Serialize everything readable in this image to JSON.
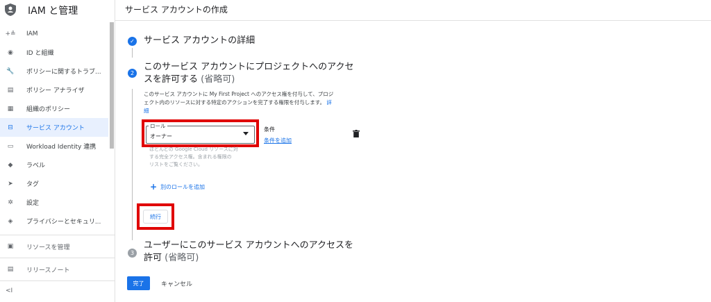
{
  "sidebar": {
    "title": "IAM と管理",
    "items": [
      {
        "label": "IAM",
        "icon": "person-add-icon",
        "glyph": "+≗"
      },
      {
        "label": "ID と組織",
        "icon": "account-circle-icon",
        "glyph": "◉"
      },
      {
        "label": "ポリシーに関するトラブ...",
        "icon": "wrench-icon",
        "glyph": "🔧"
      },
      {
        "label": "ポリシー アナライザ",
        "icon": "policy-analyzer-icon",
        "glyph": "▤"
      },
      {
        "label": "組織のポリシー",
        "icon": "list-box-icon",
        "glyph": "▦"
      },
      {
        "label": "サービス アカウント",
        "icon": "service-account-icon",
        "glyph": "⊟"
      },
      {
        "label": "Workload Identity 連携",
        "icon": "id-card-icon",
        "glyph": "▭"
      },
      {
        "label": "ラベル",
        "icon": "label-icon",
        "glyph": "◆"
      },
      {
        "label": "タグ",
        "icon": "tag-icon",
        "glyph": "➤"
      },
      {
        "label": "設定",
        "icon": "gear-icon",
        "glyph": "✲"
      },
      {
        "label": "プライバシーとセキュリ...",
        "icon": "shield-icon",
        "glyph": "◈"
      }
    ],
    "bottom": [
      {
        "label": "リソースを管理",
        "icon": "folder-icon",
        "glyph": "▣"
      },
      {
        "label": "リリースノート",
        "icon": "notes-icon",
        "glyph": "▤"
      }
    ],
    "collapse": "<I"
  },
  "header": {
    "title": "サービス アカウントの作成"
  },
  "steps": {
    "one": {
      "title": "サービス アカウントの詳細",
      "check": "✓"
    },
    "two": {
      "number": "2",
      "title_line1": "このサービス アカウントにプロジェクトへのアクセ",
      "title_line2": "スを許可する",
      "optional": "(省略可)",
      "desc_line1": "このサービス アカウントに My First Project へのアクセス権を付与して、プロジ",
      "desc_line2": "ェクト内のリソースに対する特定のアクションを完了する権限を付与します。",
      "desc_link1": "詳",
      "desc_link2": "細",
      "role_label": "ロール",
      "role_value": "オーナー",
      "role_help1": "ほとんどの Google Cloud リソースに対",
      "role_help2": "する完全アクセス権。含まれる権限の",
      "role_help3": "リストをご覧ください。",
      "condition_label": "条件",
      "condition_link": "条件を追加",
      "add_role": "別のロールを追加",
      "continue": "続行"
    },
    "three": {
      "number": "3",
      "title_line1": "ユーザーにこのサービス アカウントへのアクセスを",
      "title_line2": "許可",
      "optional": "(省略可)"
    }
  },
  "actions": {
    "done": "完了",
    "cancel": "キャンセル"
  },
  "colors": {
    "accent": "#1a73e8",
    "highlight": "#e00000"
  }
}
